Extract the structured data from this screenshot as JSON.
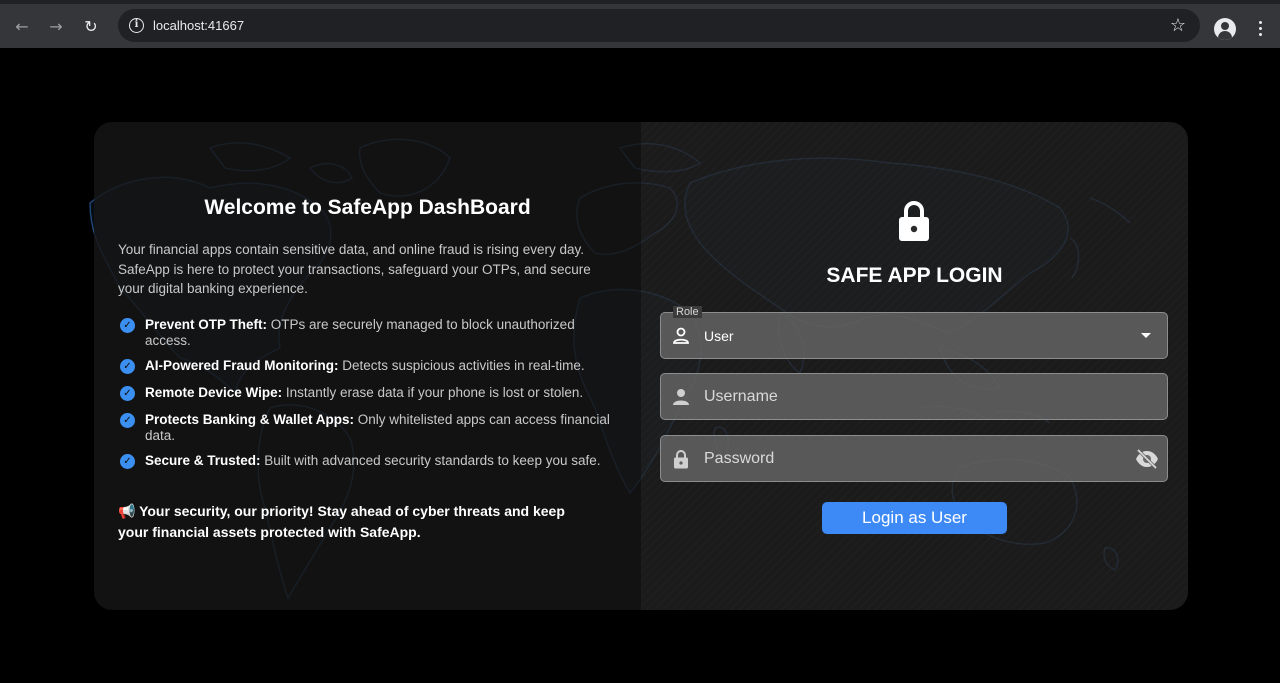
{
  "browser": {
    "url": "localhost:41667",
    "icons": [
      "back-icon",
      "forward-icon",
      "reload-icon",
      "info-icon",
      "star-icon",
      "profile-icon",
      "menu-icon"
    ]
  },
  "welcome": {
    "title": "Welcome to SafeApp DashBoard",
    "intro": "Your financial apps contain sensitive data, and online fraud is rising every day. SafeApp is here to protect your transactions, safeguard your OTPs, and secure your digital banking experience.",
    "features": [
      {
        "title": "Prevent OTP Theft:",
        "text": " OTPs are securely managed to block unauthorized access."
      },
      {
        "title": "AI-Powered Fraud Monitoring:",
        "text": " Detects suspicious activities in real-time."
      },
      {
        "title": "Remote Device Wipe:",
        "text": " Instantly erase data if your phone is lost or stolen."
      },
      {
        "title": "Protects Banking & Wallet Apps:",
        "text": " Only whitelisted apps can access financial data."
      },
      {
        "title": "Secure & Trusted:",
        "text": " Built with advanced security standards to keep you safe."
      }
    ],
    "tagline_icon": "📢",
    "tagline": " Your security, our priority! Stay ahead of cyber threats and keep your financial assets protected with SafeApp."
  },
  "login": {
    "title": "SAFE APP LOGIN",
    "role_label": "Role",
    "role_value": "User",
    "username_placeholder": "Username",
    "password_placeholder": "Password",
    "button_label": "Login as User"
  },
  "colors": {
    "accent": "#3d8af7",
    "check": "#3b8ff0",
    "map_lines": "#2c5f9e"
  }
}
